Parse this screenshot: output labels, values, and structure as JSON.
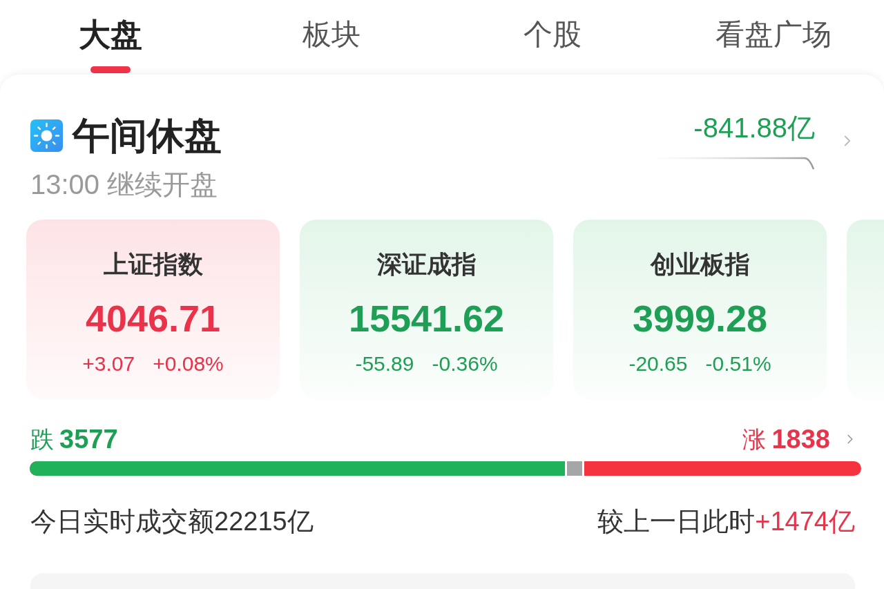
{
  "tabs": [
    {
      "label": "大盘",
      "selected": true
    },
    {
      "label": "板块",
      "selected": false
    },
    {
      "label": "个股",
      "selected": false
    },
    {
      "label": "看盘广场",
      "selected": false
    }
  ],
  "status": {
    "title": "午间休盘",
    "subtitle": "13:00 继续开盘"
  },
  "net_flow": {
    "value": "-841.88亿",
    "rising": false
  },
  "indices": [
    {
      "name": "上证指数",
      "value": "4046.71",
      "change": "+3.07",
      "change_pct": "+0.08%",
      "rising": true
    },
    {
      "name": "深证成指",
      "value": "15541.62",
      "change": "-55.89",
      "change_pct": "-0.36%",
      "rising": false
    },
    {
      "name": "创业板指",
      "value": "3999.28",
      "change": "-20.65",
      "change_pct": "-0.51%",
      "rising": false
    },
    {
      "rising": false
    }
  ],
  "breadth": {
    "down_label": "跌",
    "down_count": "3577",
    "up_label": "涨",
    "up_count": "1838",
    "level": 0.644
  },
  "turnover": {
    "text": "今日实时成交额22215亿",
    "compare_label": "较上一日此时",
    "compare_value": "+1474亿",
    "compare_rising": true
  }
}
